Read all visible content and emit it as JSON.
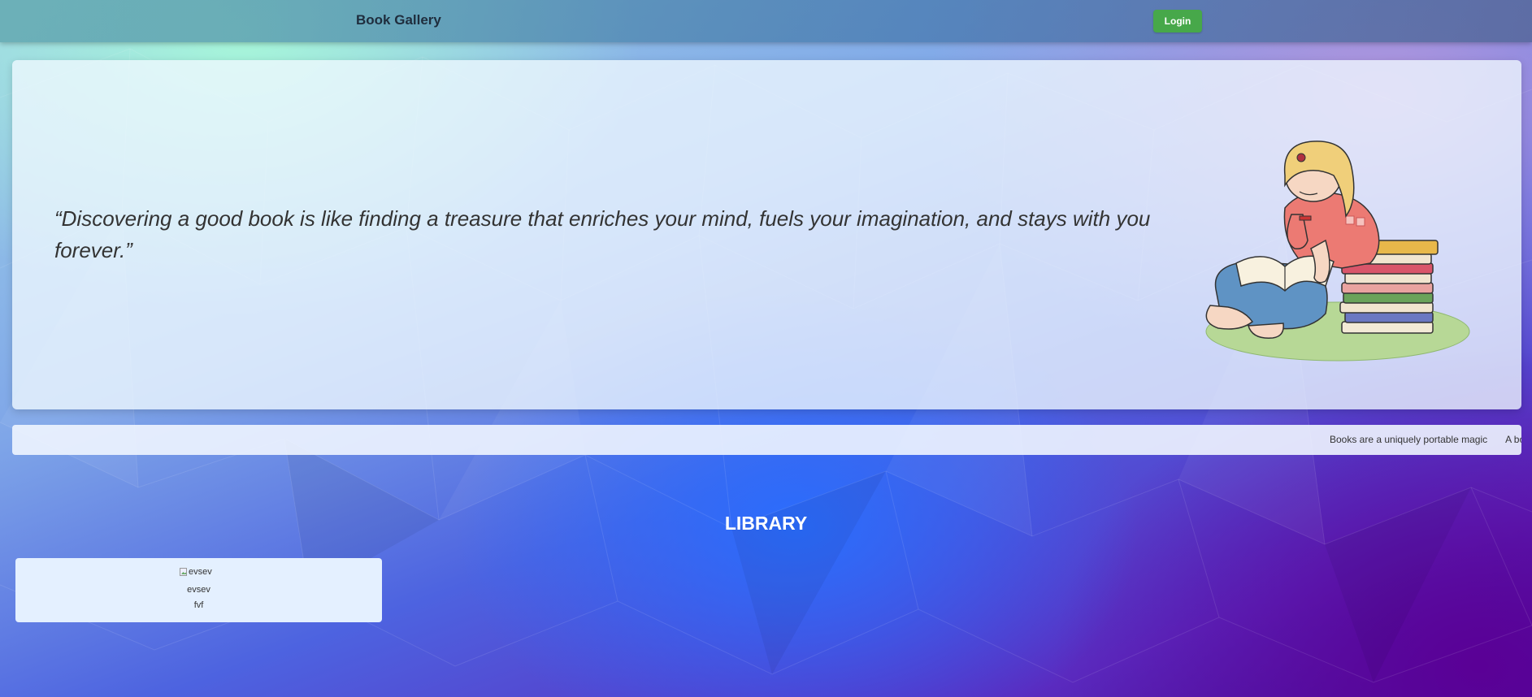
{
  "navbar": {
    "brand": "Book Gallery",
    "login_label": "Login"
  },
  "hero": {
    "quote": "“Discovering a good book is like finding a treasure that enriches your mind, fuels your imagination, and stays with you forever.”",
    "illustration": "girl-reading-books-illustration"
  },
  "ticker": {
    "items": [
      "Books are a uniquely portable magic",
      "A bo"
    ]
  },
  "library": {
    "title": "LIBRARY",
    "books": [
      {
        "image_alt": "evsev",
        "title": "evsev",
        "description": "fvf"
      }
    ]
  },
  "colors": {
    "login_button": "#47a84a",
    "card_background": "#e4f0ff",
    "brand_text": "#1f2d3d"
  }
}
